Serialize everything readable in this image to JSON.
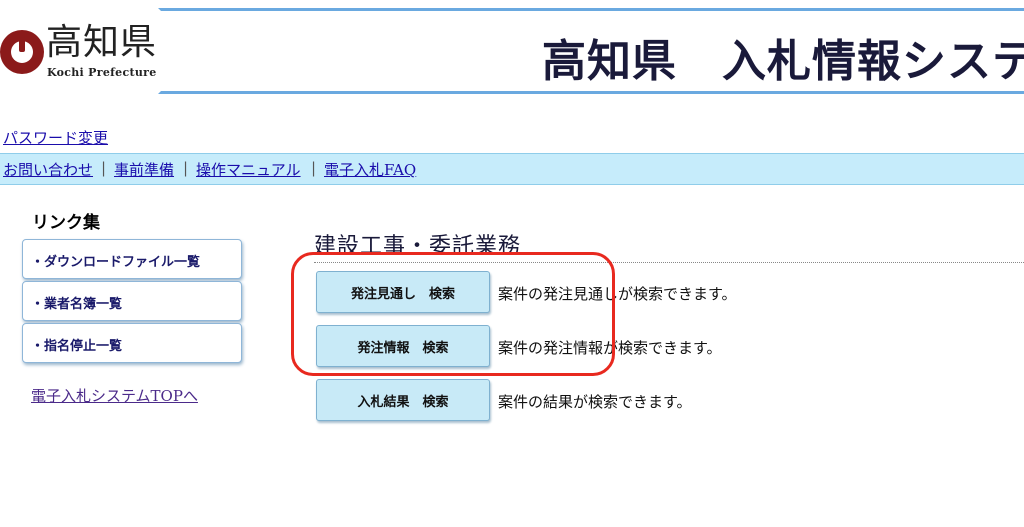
{
  "header": {
    "logo_kanji": "高知県",
    "logo_en": "Kochi Prefecture",
    "title": "高知県　入札情報システ"
  },
  "password_link": "パスワード変更",
  "nav": {
    "items": [
      "お問い合わせ",
      "事前準備",
      "操作マニュアル",
      "電子入札FAQ"
    ],
    "separator": "|"
  },
  "sidebar": {
    "title": "リンク集",
    "items": [
      "・ダウンロードファイル一覧",
      "・業者名簿一覧",
      "・指名停止一覧"
    ],
    "top_link": "電子入札システムTOPへ"
  },
  "main": {
    "section_title": "建設工事・委託業務",
    "buttons": [
      {
        "label": "発注見通し　検索",
        "desc": "案件の発注見通しが検索できます。"
      },
      {
        "label": "発注情報　検索",
        "desc": "案件の発注情報が検索できます。"
      },
      {
        "label": "入札結果　検索",
        "desc": "案件の結果が検索できます。"
      }
    ]
  },
  "colors": {
    "nav_bg": "#c6ecfb",
    "header_rule": "#6aa9e0",
    "button_bg": "#c8eaf7",
    "highlight": "#e8291f",
    "seal": "#8b1a1a"
  }
}
